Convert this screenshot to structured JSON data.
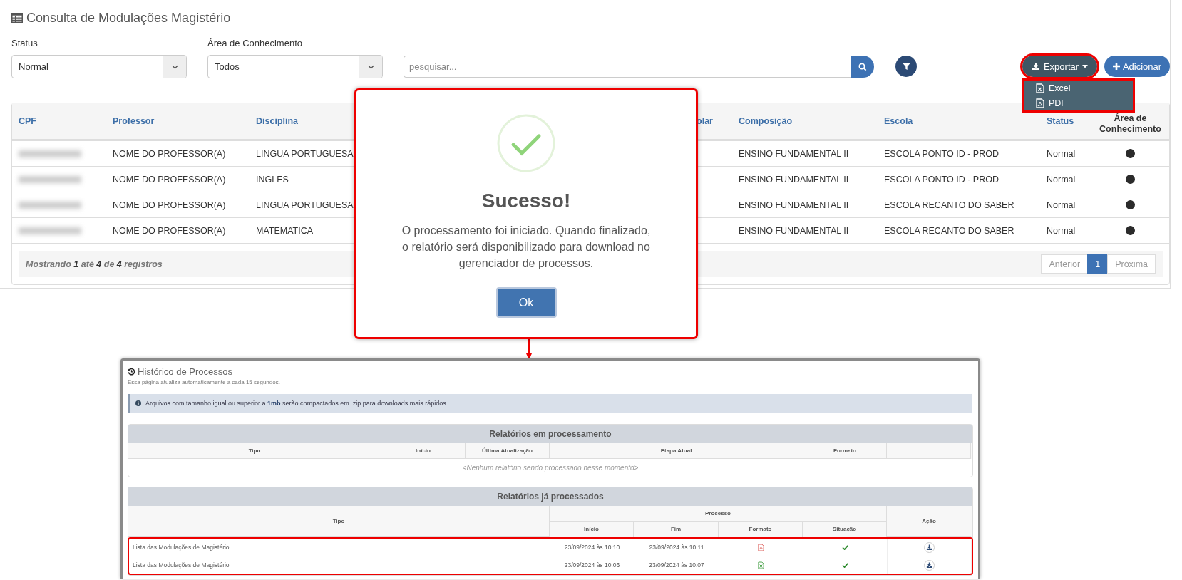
{
  "page": {
    "title": "Consulta de Modulações Magistério"
  },
  "filters": [
    {
      "kind": "select",
      "label": "Status",
      "value": "Normal"
    },
    {
      "kind": "select",
      "label": "Área de Conhecimento",
      "value": "Todos"
    }
  ],
  "search": {
    "placeholder": "pesquisar..."
  },
  "export_button": {
    "label": "Exportar",
    "expanded": true
  },
  "export_menu": [
    {
      "kind": "excel",
      "label": "Excel"
    },
    {
      "kind": "pdf",
      "label": "PDF"
    }
  ],
  "add_button": {
    "label": "Adicionar"
  },
  "table": {
    "columns": [
      "CPF",
      "Professor",
      "Disciplina",
      "olar",
      "Composição",
      "Escola",
      "Status",
      "Área de Conhecimento"
    ],
    "rows": [
      {
        "cpf_redacted": true,
        "professor": "NOME DO PROFESSOR(A)",
        "disciplina": "LINGUA PORTUGUESA",
        "composicao": "ENSINO FUNDAMENTAL II",
        "escola": "ESCOLA PONTO ID - PROD",
        "status": "Normal"
      },
      {
        "cpf_redacted": true,
        "professor": "NOME DO PROFESSOR(A)",
        "disciplina": "INGLES",
        "composicao": "ENSINO FUNDAMENTAL II",
        "escola": "ESCOLA PONTO ID - PROD",
        "status": "Normal"
      },
      {
        "cpf_redacted": true,
        "professor": "NOME DO PROFESSOR(A)",
        "disciplina": "LINGUA PORTUGUESA",
        "composicao": "ENSINO FUNDAMENTAL II",
        "escola": "ESCOLA RECANTO DO SABER",
        "status": "Normal"
      },
      {
        "cpf_redacted": true,
        "professor": "NOME DO PROFESSOR(A)",
        "disciplina": "MATEMATICA",
        "composicao": "ENSINO FUNDAMENTAL II",
        "escola": "ESCOLA RECANTO DO SABER",
        "status": "Normal"
      }
    ],
    "footer": "Mostrando **1** até **4** de **4** registros",
    "pagination": [
      {
        "label": "Anterior",
        "selected": false
      },
      {
        "label": "1",
        "selected": true
      },
      {
        "label": "Próxima",
        "selected": false
      }
    ]
  },
  "modal": {
    "title": "Sucesso!",
    "message": "O processamento foi iniciado. Quando finalizado, o relatório será disponibilizado para download no gerenciador de processos.",
    "button": "Ok"
  },
  "history": {
    "title": "Histórico de Processos",
    "note": "Essa página atualiza automaticamente a cada 15 segundos.",
    "alert": "Arquivos com tamanho igual ou superior a **1mb** serão compactados em .zip para downloads mais rápidos.",
    "processing": {
      "title": "Relatórios em processamento",
      "columns": [
        "Tipo",
        "Início",
        "Última Atualização",
        "Etapa Atual",
        "Formato"
      ],
      "empty": "<Nenhum relatório sendo processado nesse momento>"
    },
    "processed": {
      "title": "Relatórios já processados",
      "type_column": "Tipo",
      "group": "Processo",
      "columns": [
        "Início",
        "Fim",
        "Formato",
        "Situação"
      ],
      "action_column": "Ação",
      "rows": [
        {
          "tipo": "Lista das Modulações de Magistério",
          "inicio": "23/09/2024 às 10:10",
          "fim": "23/09/2024 às 10:11",
          "kind": "pdf",
          "succeeded": true
        },
        {
          "tipo": "Lista das Modulações de Magistério",
          "inicio": "23/09/2024 às 10:06",
          "fim": "23/09/2024 às 10:07",
          "kind": "excel",
          "succeeded": true
        }
      ]
    }
  }
}
